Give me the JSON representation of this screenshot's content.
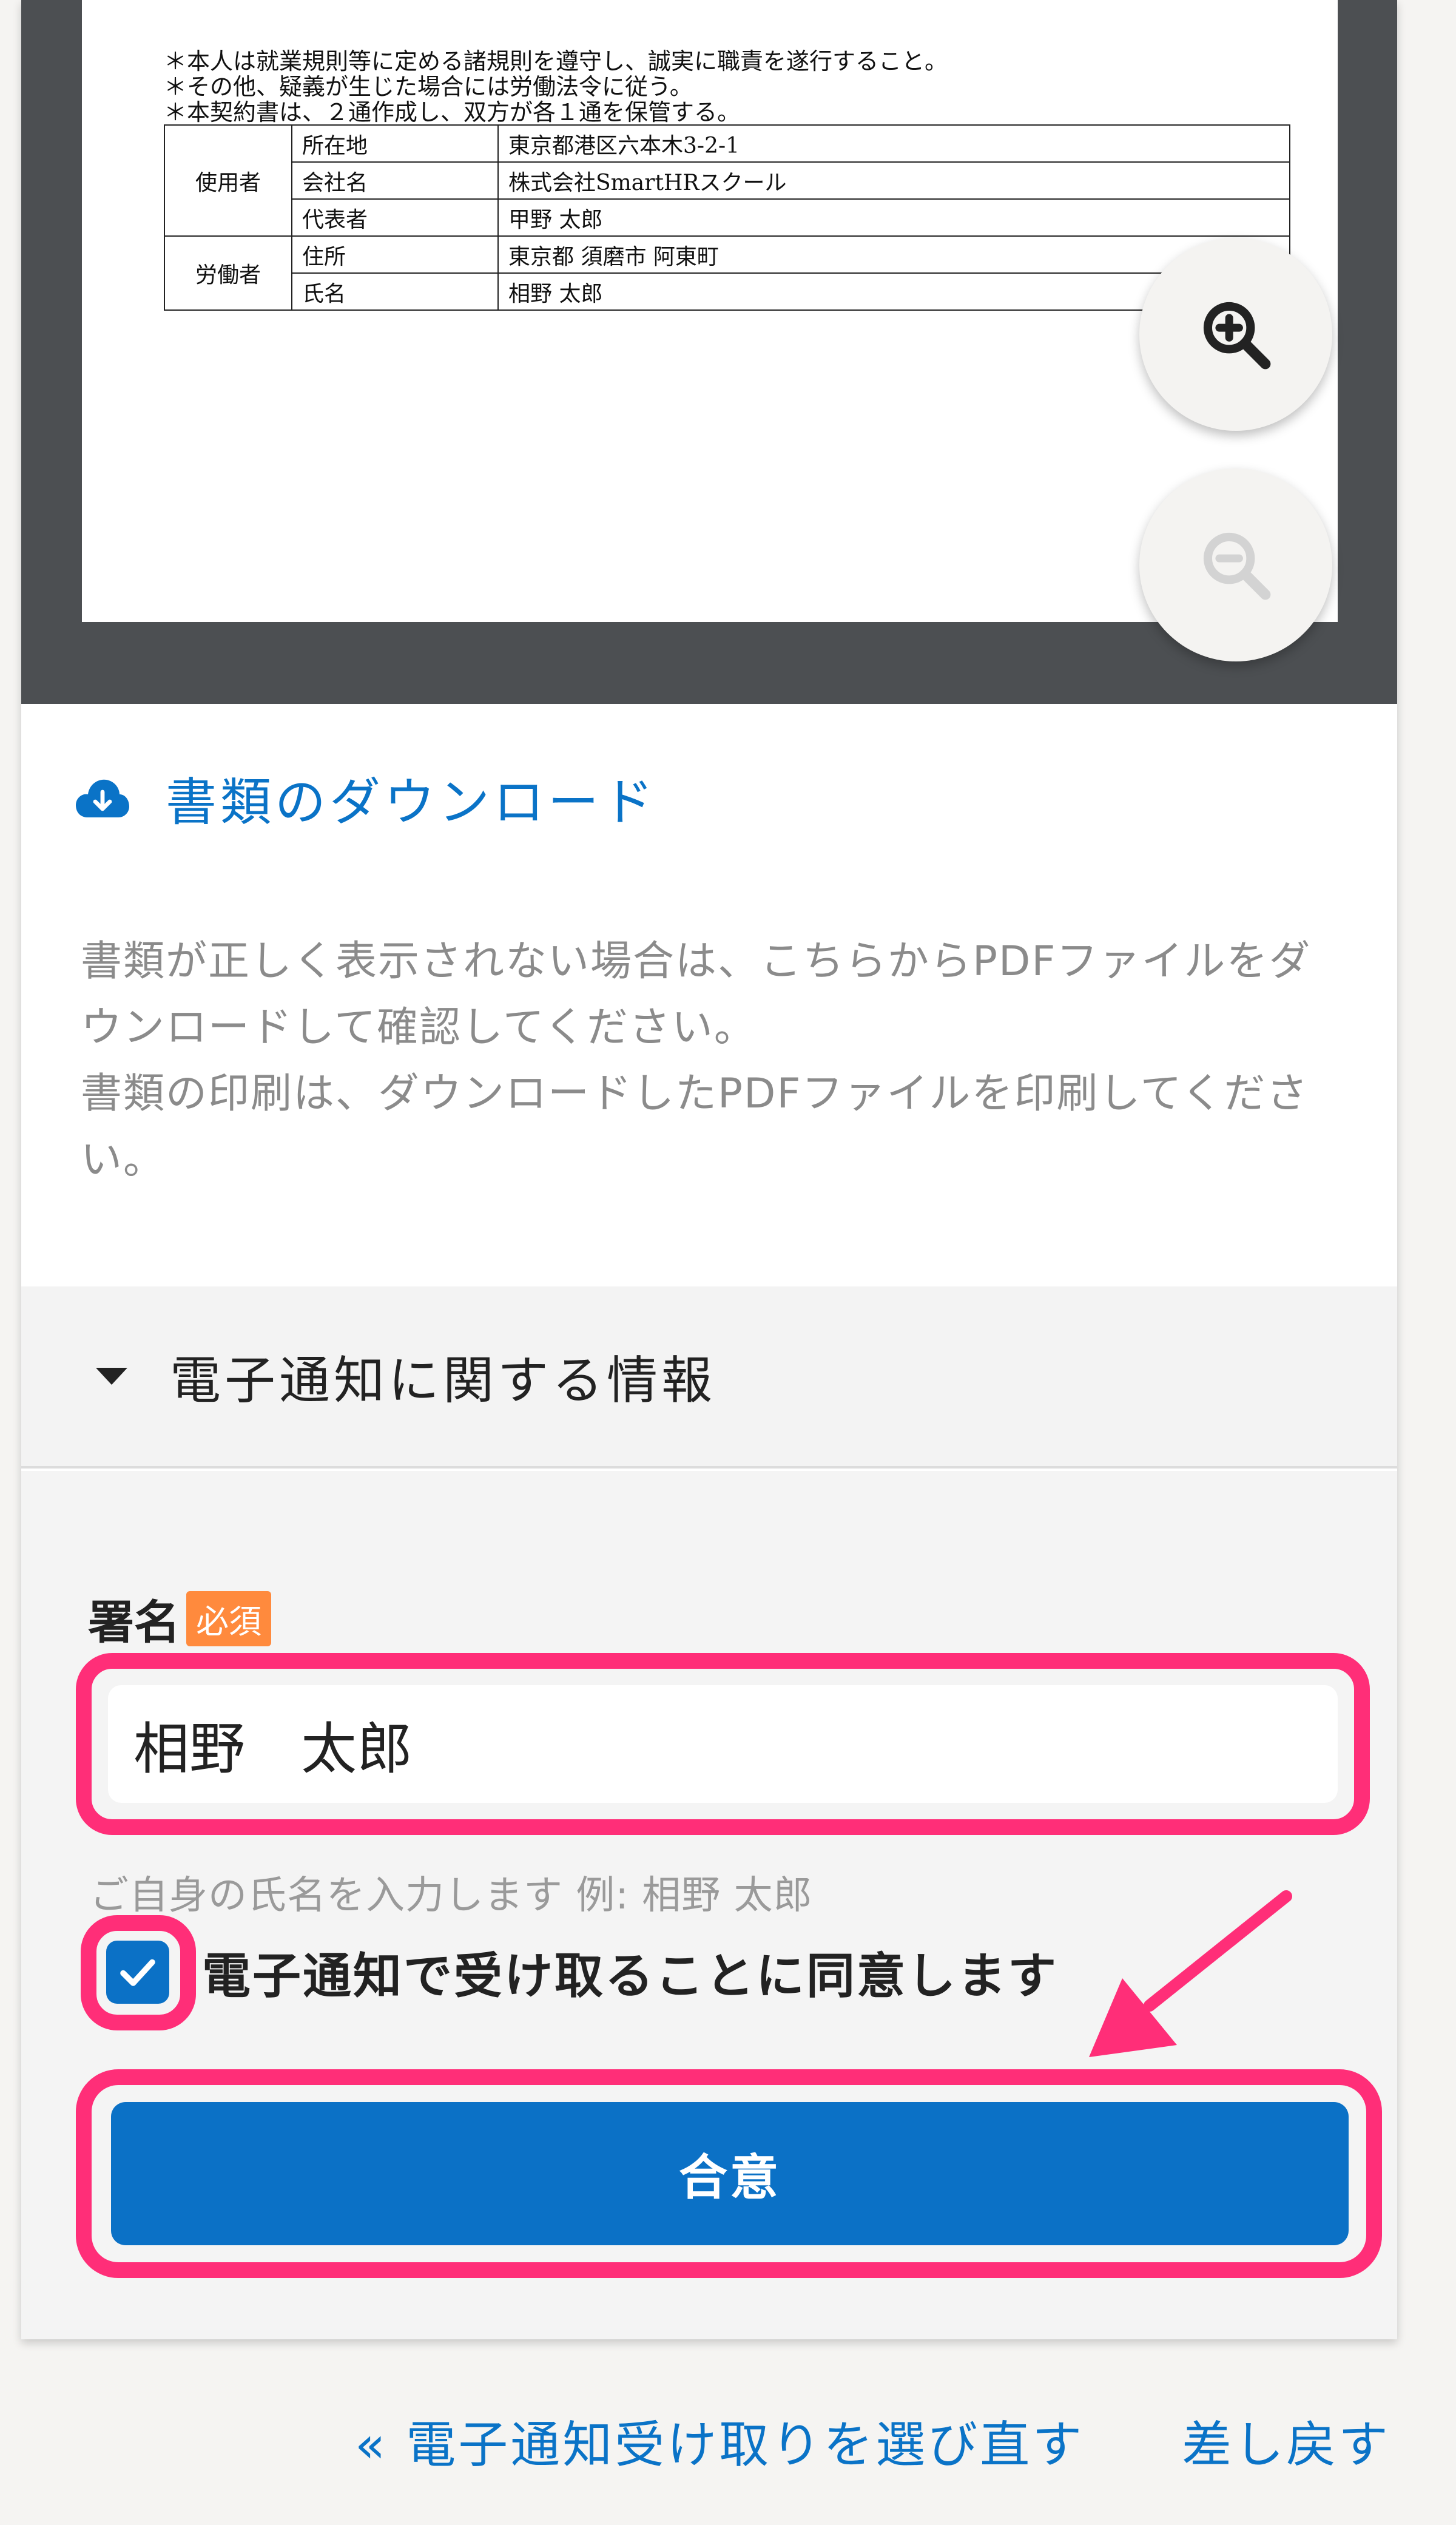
{
  "document": {
    "clauses": [
      "＊本人は就業規則等に定める諸規則を遵守し、誠実に職責を遂行すること。",
      "＊その他、疑義が生じた場合には労働法令に従う。",
      "＊本契約書は、２通作成し、双方が各１通を保管する。"
    ],
    "table": {
      "employer": {
        "group": "使用者",
        "rows": [
          {
            "label": "所在地",
            "value": "東京都港区六本木3-2-1"
          },
          {
            "label": "会社名",
            "value": "株式会社SmartHRスクール"
          },
          {
            "label": "代表者",
            "value": "甲野 太郎"
          }
        ]
      },
      "worker": {
        "group": "労働者",
        "rows": [
          {
            "label": "住所",
            "value": "東京都 須磨市 阿東町"
          },
          {
            "label": "氏名",
            "value": "相野 太郎"
          }
        ]
      }
    }
  },
  "viewer": {
    "zoom_in_icon": "zoom-in-icon",
    "zoom_out_icon": "zoom-out-icon"
  },
  "download": {
    "icon": "cloud-download-icon",
    "label": "書類のダウンロード",
    "help_lines": [
      "書類が正しく表示されない場合は、こちらからPDFファイルをダ",
      "ウンロードして確認してください。",
      "書類の印刷は、ダウンロードしたPDFファイルを印刷してくださ",
      "い。"
    ]
  },
  "section": {
    "title": "電子通知に関する情報",
    "icon": "triangle-down-icon"
  },
  "form": {
    "signature_label": "署名",
    "required_badge": "必須",
    "signature_value": "相野　太郎",
    "signature_hint": "ご自身の氏名を入力します 例: 相野 太郎",
    "consent_label": "電子通知で受け取ることに同意します",
    "consent_checked": true,
    "agree_button": "合意"
  },
  "footer": {
    "reselect_link": "« 電子通知受け取りを選び直す",
    "return_link": "差し戻す"
  },
  "colors": {
    "accent_blue": "#0b71c6",
    "link_blue": "#0a73c7",
    "highlight_pink": "#ff2e78",
    "required_orange": "#ff8a3d",
    "viewer_gray": "#4c4f52"
  }
}
